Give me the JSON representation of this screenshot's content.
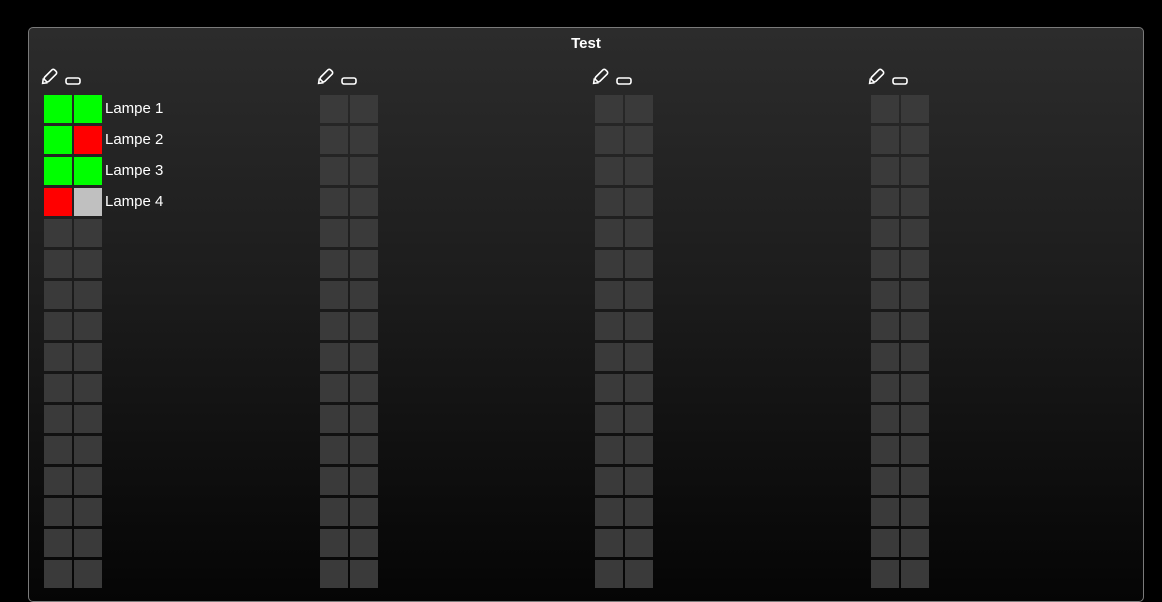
{
  "panel": {
    "title": "Test"
  },
  "colors": {
    "green": "#00ff00",
    "red": "#ff0000",
    "gray": "#c0c0c0",
    "empty": "#3a3a3a"
  },
  "icons": {
    "edit": "pencil-icon",
    "toggle": "rectangle-icon"
  },
  "columns": [
    {
      "lamps": [
        {
          "label": "Lampe 1",
          "states": [
            "green",
            "green"
          ]
        },
        {
          "label": "Lampe 2",
          "states": [
            "green",
            "red"
          ]
        },
        {
          "label": "Lampe 3",
          "states": [
            "green",
            "green"
          ]
        },
        {
          "label": "Lampe 4",
          "states": [
            "red",
            "gray"
          ]
        }
      ]
    },
    {
      "lamps": []
    },
    {
      "lamps": []
    },
    {
      "lamps": []
    }
  ],
  "slots_per_column": 16
}
